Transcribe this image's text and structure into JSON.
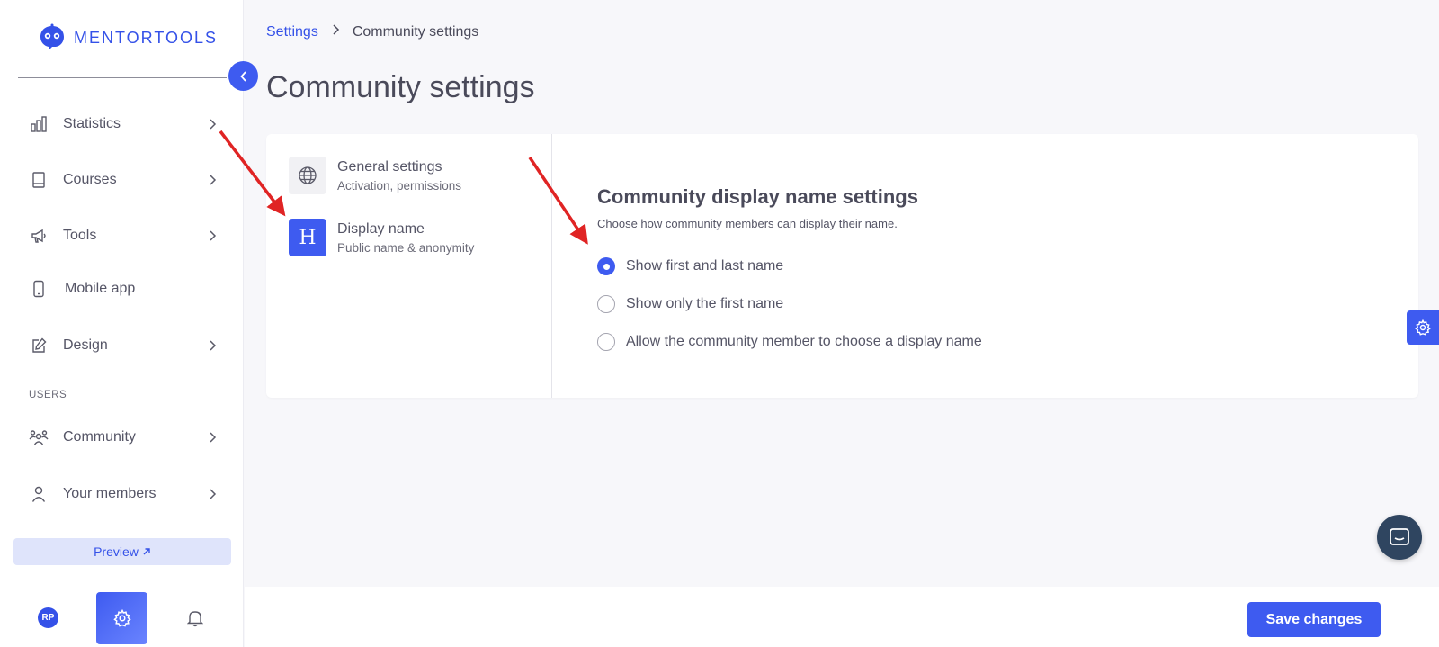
{
  "app": {
    "logo_text": "MENTORTOOLS"
  },
  "sidebar": {
    "items": [
      {
        "label": "Statistics",
        "icon": "bar-chart-icon"
      },
      {
        "label": "Courses",
        "icon": "book-icon"
      },
      {
        "label": "Tools",
        "icon": "megaphone-icon"
      },
      {
        "label": "Mobile app",
        "icon": "smartphone-icon"
      },
      {
        "label": "Design",
        "icon": "pencil-icon"
      }
    ],
    "users_section_label": "USERS",
    "user_items": [
      {
        "label": "Community",
        "icon": "people-icon"
      },
      {
        "label": "Your members",
        "icon": "user-icon"
      }
    ],
    "preview_label": "Preview",
    "avatar_initials": "RP"
  },
  "breadcrumb": {
    "parent": "Settings",
    "current": "Community settings"
  },
  "page": {
    "title": "Community settings"
  },
  "settings_menu": [
    {
      "title": "General settings",
      "subtitle": "Activation, permissions",
      "icon": "globe-icon"
    },
    {
      "title": "Display name",
      "subtitle": "Public name & anonymity",
      "icon": "heading-icon",
      "icon_text": "H",
      "active": true
    }
  ],
  "display_name": {
    "title": "Community display name settings",
    "description": "Choose how community members can display their name.",
    "options": [
      {
        "label": "Show first and last name",
        "selected": true
      },
      {
        "label": "Show only the first name",
        "selected": false
      },
      {
        "label": "Allow the community member to choose a display name",
        "selected": false
      }
    ]
  },
  "footer": {
    "save_label": "Save changes"
  },
  "colors": {
    "accent": "#3e5bf0",
    "annotation_arrow": "#e02424",
    "chat": "#2f4560"
  }
}
